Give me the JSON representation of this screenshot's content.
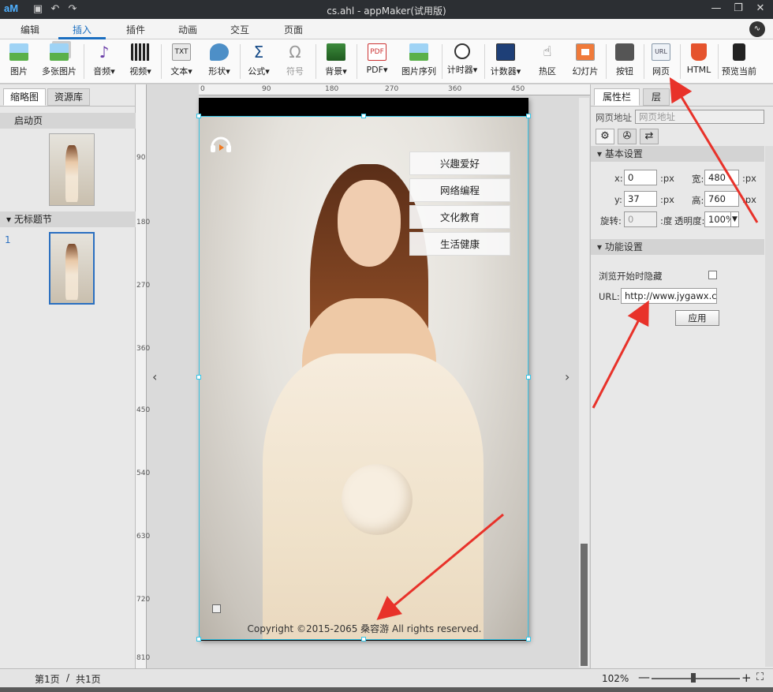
{
  "app": {
    "logo": "aM",
    "title": "cs.ahl - appMaker(试用版)"
  },
  "ribbon_tabs": [
    "编辑",
    "插入",
    "插件",
    "动画",
    "交互",
    "页面"
  ],
  "active_tab": "插入",
  "toolbar": {
    "items": [
      "图片",
      "多张图片",
      "音频▾",
      "视频▾",
      "文本▾",
      "形状▾",
      "公式▾",
      "符号",
      "背景▾",
      "PDF▾",
      "图片序列",
      "计时器▾",
      "计数器▾",
      "热区",
      "幻灯片",
      "按钮",
      "网页",
      "HTML",
      "预览当前"
    ]
  },
  "left_panel": {
    "tabs": [
      "缩略图",
      "资源库"
    ],
    "start_page_label": "启动页",
    "section_label": "无标题节",
    "page_number": "1"
  },
  "rulers": {
    "h_labels": [
      "0",
      "90",
      "180",
      "270",
      "360",
      "450"
    ],
    "v_labels": [
      "90",
      "180",
      "270",
      "360",
      "450",
      "540",
      "630",
      "720",
      "810"
    ]
  },
  "canvas": {
    "menu_buttons": [
      "兴趣爱好",
      "网络编程",
      "文化教育",
      "生活健康"
    ],
    "copyright": "Copyright ©2015-2065 桑容游 All rights reserved."
  },
  "right_panel": {
    "tabs": [
      "属性栏",
      "层"
    ],
    "address_label": "网页地址",
    "address_value": "网页地址",
    "basic_section": "基本设置",
    "x_label": "x:",
    "x_value": "0",
    "y_label": "y:",
    "y_value": "37",
    "w_label": "宽:",
    "w_value": "480",
    "h_label": "高:",
    "h_value": "760",
    "unit": ":px",
    "rotate_label": "旋转:",
    "rotate_value": "0",
    "rotate_unit": ":度",
    "opacity_label": "透明度:",
    "opacity_value": "100%",
    "func_section": "功能设置",
    "hide_label": "浏览开始时隐藏",
    "url_label": "URL:",
    "url_value": "http://www.jygawx.com/",
    "apply_label": "应用"
  },
  "status": {
    "page_current": "第1页",
    "page_total": "共1页",
    "zoom": "102%"
  }
}
